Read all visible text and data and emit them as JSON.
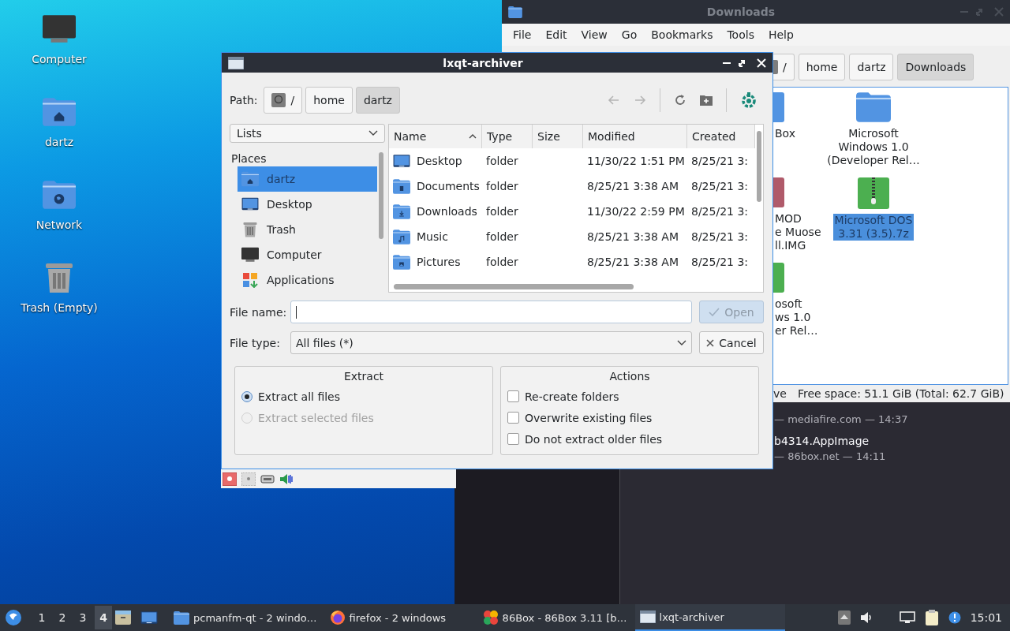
{
  "desktop_icons": [
    {
      "label": "Computer",
      "kind": "computer"
    },
    {
      "label": "dartz",
      "kind": "home"
    },
    {
      "label": "Network",
      "kind": "network"
    },
    {
      "label": "Trash (Empty)",
      "kind": "trash"
    }
  ],
  "file_manager": {
    "title": "Downloads",
    "menu": [
      "File",
      "Edit",
      "View",
      "Go",
      "Bookmarks",
      "Tools",
      "Help"
    ],
    "path": [
      {
        "label": "/",
        "kind": "root",
        "selected": false
      },
      {
        "label": "home",
        "kind": "dir",
        "selected": false
      },
      {
        "label": "dartz",
        "kind": "dir",
        "selected": false
      },
      {
        "label": "Downloads",
        "kind": "dir",
        "selected": true
      }
    ],
    "items": [
      {
        "lines": [
          "Box"
        ],
        "kind": "folder",
        "selected": false
      },
      {
        "lines": [
          "Microsoft",
          "Windows 1.0",
          "(Developer Rel…"
        ],
        "kind": "folder",
        "selected": false
      },
      {
        "lines": [
          "MOD",
          "e Muose",
          "ll.IMG"
        ],
        "kind": "image",
        "selected": false
      },
      {
        "lines": [
          "Microsoft DOS",
          "3.31 (3.5).7z"
        ],
        "kind": "archive",
        "selected": true
      },
      {
        "lines": [
          "osoft",
          "ws 1.0",
          "er Rel…"
        ],
        "kind": "archive",
        "selected": false
      }
    ],
    "status": [
      "ve",
      "Free space: 51.1 GiB (Total: 62.7 GiB)"
    ]
  },
  "downloads_window": {
    "items": [
      {
        "source": "— mediafire.com — 14:37"
      },
      {
        "name": "b4314.AppImage",
        "source": "— 86box.net — 14:11"
      }
    ]
  },
  "archiver": {
    "title": "lxqt-archiver",
    "path_label": "Path:",
    "path": [
      {
        "label": "/",
        "kind": "root",
        "selected": false
      },
      {
        "label": "home",
        "kind": "dir",
        "selected": false
      },
      {
        "label": "dartz",
        "kind": "dir",
        "selected": true
      }
    ],
    "toolbar": [
      {
        "kind": "back",
        "disabled": true
      },
      {
        "kind": "forward",
        "disabled": true
      },
      {
        "kind": "reload",
        "disabled": false
      },
      {
        "kind": "new-folder",
        "disabled": false
      },
      {
        "kind": "app",
        "disabled": false
      }
    ],
    "places_combo": "Lists",
    "places_header": "Places",
    "places": [
      {
        "label": "dartz",
        "kind": "home",
        "selected": true
      },
      {
        "label": "Desktop",
        "kind": "desktop",
        "selected": false
      },
      {
        "label": "Trash",
        "kind": "trash",
        "selected": false
      },
      {
        "label": "Computer",
        "kind": "computer",
        "selected": false
      },
      {
        "label": "Applications",
        "kind": "apps",
        "selected": false
      }
    ],
    "columns": [
      {
        "label": "Name",
        "sorted": true
      },
      {
        "label": "Type",
        "sorted": false
      },
      {
        "label": "Size",
        "sorted": false
      },
      {
        "label": "Modified",
        "sorted": false
      },
      {
        "label": "Created",
        "sorted": false
      }
    ],
    "rows": [
      {
        "name": "Desktop",
        "kind": "desktop",
        "type": "folder",
        "modified": "11/30/22 1:51 PM",
        "created": "8/25/21 3:"
      },
      {
        "name": "Documents",
        "kind": "documents",
        "type": "folder",
        "modified": "8/25/21 3:38 AM",
        "created": "8/25/21 3:"
      },
      {
        "name": "Downloads",
        "kind": "downloads",
        "type": "folder",
        "modified": "11/30/22 2:59 PM",
        "created": "8/25/21 3:"
      },
      {
        "name": "Music",
        "kind": "music",
        "type": "folder",
        "modified": "8/25/21 3:38 AM",
        "created": "8/25/21 3:"
      },
      {
        "name": "Pictures",
        "kind": "pictures",
        "type": "folder",
        "modified": "8/25/21 3:38 AM",
        "created": "8/25/21 3:"
      }
    ],
    "file_name": {
      "label": "File name:"
    },
    "file_type": {
      "label": "File type:",
      "value": "All files (*)"
    },
    "open_button": {
      "label": "Open",
      "disabled": true
    },
    "cancel_button": {
      "label": "Cancel"
    },
    "extract": {
      "title": "Extract",
      "options": [
        {
          "label": "Extract all files",
          "selected": true,
          "disabled": false
        },
        {
          "label": "Extract selected files",
          "selected": false,
          "disabled": true
        }
      ]
    },
    "actions": {
      "title": "Actions",
      "options": [
        {
          "label": "Re-create folders",
          "checked": false
        },
        {
          "label": "Overwrite existing files",
          "checked": false
        },
        {
          "label": "Do not extract older files",
          "checked": false
        }
      ]
    }
  },
  "taskbar": {
    "workspaces": [
      {
        "label": "1",
        "selected": false
      },
      {
        "label": "2",
        "selected": false
      },
      {
        "label": "3",
        "selected": false
      },
      {
        "label": "4",
        "selected": true
      }
    ],
    "tasks": [
      {
        "label": "pcmanfm-qt - 2 windo…",
        "kind": "folder",
        "selected": false
      },
      {
        "label": "firefox - 2 windows",
        "kind": "browser",
        "selected": false
      },
      {
        "label": "86Box - 86Box 3.11 [b…",
        "kind": "emulator",
        "selected": false
      },
      {
        "label": "lxqt-archiver",
        "kind": "window",
        "selected": true
      }
    ],
    "clock": "15:01"
  }
}
